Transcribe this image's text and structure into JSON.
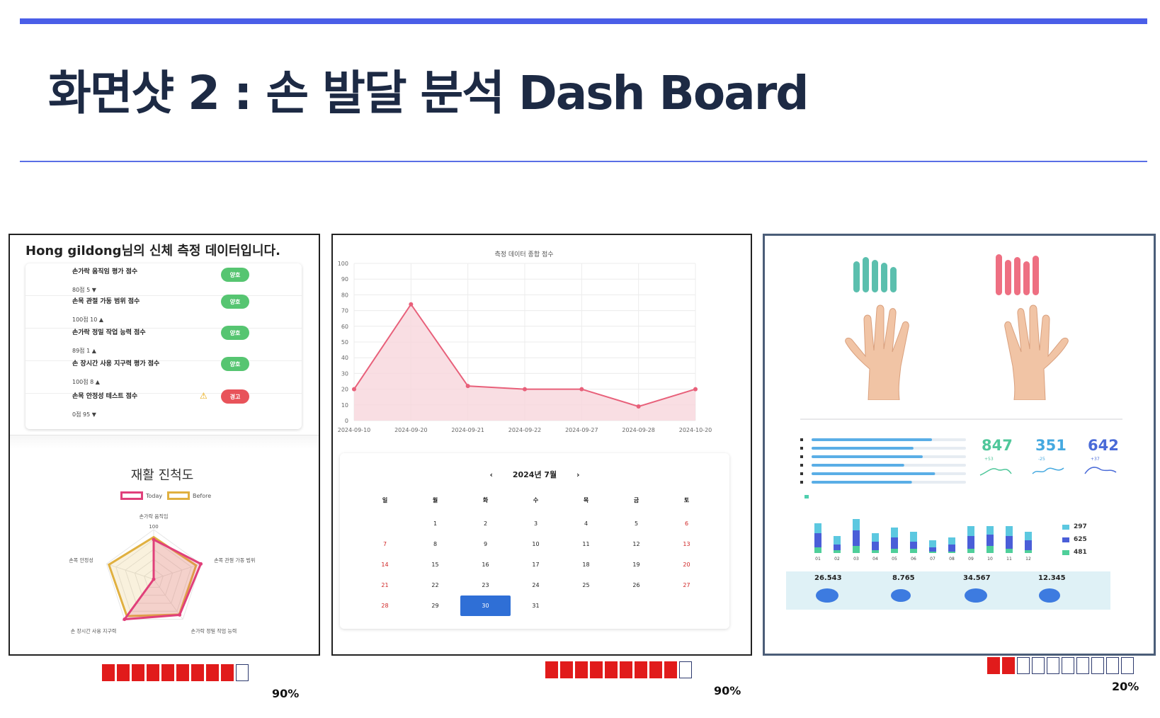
{
  "slide": {
    "title": "화면샷 2 : 손 발달 분석 Dash Board",
    "accent_color": "#4a5ee8"
  },
  "panel1": {
    "heading": "Hong gildong님의 신체 측정 데이터입니다.",
    "rows": [
      {
        "label": "손가락 움직임 평가 점수",
        "sub": "80점 5 ▼",
        "status": "양호",
        "state": "good"
      },
      {
        "label": "손목 관절 가동 범위 점수",
        "sub": "100점 10 ▲",
        "status": "양호",
        "state": "good"
      },
      {
        "label": "손가락 정밀 작업 능력 점수",
        "sub": "89점 1 ▲",
        "status": "양호",
        "state": "good"
      },
      {
        "label": "손 장시간 사용 지구력 평가 점수",
        "sub": "100점 8 ▲",
        "status": "양호",
        "state": "good"
      },
      {
        "label": "손목 안정성 테스트 점수",
        "sub": "0점 95 ▼",
        "status": "경고",
        "state": "warn"
      }
    ],
    "radar": {
      "title": "재활 진척도",
      "legend": [
        {
          "name": "Today",
          "color": "#e0407a"
        },
        {
          "name": "Before",
          "color": "#e0b040"
        }
      ],
      "axes": [
        "손가락 움직임",
        "손목 관절 가동 범위",
        "손가락 정밀 작업 능력",
        "손 장시간 사용 지구력",
        "손목 안정성"
      ],
      "max_label": "100",
      "max": 100,
      "today": [
        80,
        100,
        89,
        100,
        0
      ],
      "before": [
        85,
        90,
        88,
        92,
        95
      ]
    }
  },
  "panel2": {
    "chart_data": {
      "type": "area",
      "title": "측정 데이터 종합 점수",
      "x": [
        "2024-09-10",
        "2024-09-20",
        "2024-09-21",
        "2024-09-22",
        "2024-09-27",
        "2024-09-28",
        "2024-10-20"
      ],
      "values": [
        20,
        74,
        22,
        20,
        20,
        9,
        20
      ],
      "ylim": [
        0,
        100
      ],
      "yticks": [
        0,
        10,
        20,
        30,
        40,
        50,
        60,
        70,
        80,
        90,
        100
      ],
      "grid": true,
      "line_color": "#e8607a",
      "fill_color": "#f8d6dc"
    },
    "calendar": {
      "prev": "‹",
      "next": "›",
      "month_label": "2024년 7월",
      "weekdays": [
        "일",
        "월",
        "화",
        "수",
        "목",
        "금",
        "토"
      ],
      "start_offset": 1,
      "days": 31,
      "selected": 30
    }
  },
  "panel3": {
    "top_colors": {
      "left": "#5bbfae",
      "right": "#ee6f82"
    },
    "stats": [
      {
        "value": "847",
        "delta": "+53",
        "color": "#4fc79a"
      },
      {
        "value": "351",
        "delta": "-25",
        "color": "#45a9e0"
      },
      {
        "value": "642",
        "delta": "+37",
        "color": "#4a6bd8"
      }
    ],
    "hbar_values": [
      0.78,
      0.66,
      0.72,
      0.6,
      0.8,
      0.65
    ],
    "bar_labels": [
      "01",
      "02",
      "03",
      "04",
      "05",
      "06",
      "07",
      "08",
      "09",
      "10",
      "11",
      "12"
    ],
    "stack_values": [
      [
        14,
        20,
        8
      ],
      [
        12,
        8,
        4
      ],
      [
        16,
        22,
        10
      ],
      [
        12,
        12,
        4
      ],
      [
        14,
        16,
        6
      ],
      [
        14,
        10,
        6
      ],
      [
        10,
        6,
        2
      ],
      [
        10,
        10,
        2
      ],
      [
        14,
        18,
        6
      ],
      [
        12,
        16,
        10
      ],
      [
        14,
        18,
        6
      ],
      [
        12,
        14,
        4
      ]
    ],
    "legend": [
      {
        "value": "297",
        "color": "#5cc8e0"
      },
      {
        "value": "625",
        "color": "#4a5ed8"
      },
      {
        "value": "481",
        "color": "#4fcf9a"
      }
    ],
    "footer": [
      "26.543",
      "8.765",
      "34.567",
      "12.345"
    ]
  },
  "meters": [
    {
      "label": "90%",
      "filled": 0.9
    },
    {
      "label": "90%",
      "filled": 0.9
    },
    {
      "label": "20%",
      "filled": 0.2
    }
  ]
}
